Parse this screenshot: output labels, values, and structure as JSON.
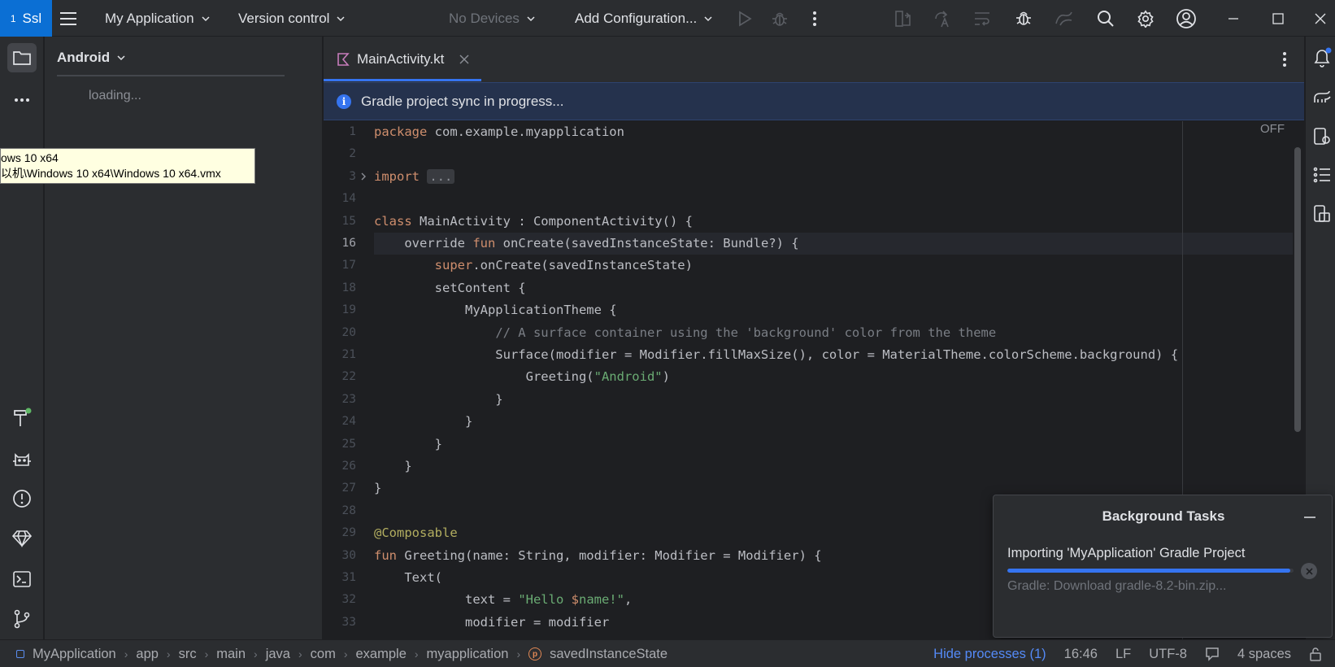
{
  "titlebar": {
    "ssl_tab_prefix": "1",
    "ssl_tab_label": "Ssl",
    "project_name": "My Application",
    "vcs_label": "Version control",
    "devices_label": "No Devices",
    "config_label": "Add Configuration..."
  },
  "project_panel": {
    "view_label": "Android",
    "loading_text": "loading..."
  },
  "tooltip": {
    "line1": "ows 10 x64",
    "line2": "以机\\Windows 10 x64\\Windows 10 x64.vmx"
  },
  "editor": {
    "tab_name": "MainActivity.kt",
    "banner_text": "Gradle project sync in progress...",
    "off_label": "OFF",
    "line_numbers": [
      "1",
      "2",
      "3",
      "14",
      "15",
      "16",
      "17",
      "18",
      "19",
      "20",
      "21",
      "22",
      "23",
      "24",
      "25",
      "26",
      "27",
      "28",
      "29",
      "30",
      "31",
      "32",
      "33"
    ],
    "current_line_index": 5,
    "fold_line_index": 2
  },
  "background_tasks": {
    "title": "Background Tasks",
    "task_name": "Importing 'MyApplication' Gradle Project",
    "task_detail": "Gradle: Download gradle-8.2-bin.zip...",
    "progress": 0.99
  },
  "statusbar": {
    "breadcrumbs": [
      "MyApplication",
      "app",
      "src",
      "main",
      "java",
      "com",
      "example",
      "myapplication",
      "savedInstanceState"
    ],
    "param_badge": "p",
    "hide_processes": "Hide processes (1)",
    "time": "16:46",
    "line_separator": "LF",
    "encoding": "UTF-8",
    "indent": "4 spaces"
  },
  "icons": {
    "menu": "hamburger-icon",
    "run": "play-icon",
    "debug": "bug-icon",
    "search": "search-icon",
    "settings": "gear-icon",
    "account": "user-circle-icon"
  },
  "colors": {
    "accent": "#3574f0",
    "ssl_tab": "#0b6fd4",
    "banner_bg": "#25324d",
    "keyword": "#cf8e6d",
    "string": "#6aab73",
    "comment": "#7a7e85"
  }
}
